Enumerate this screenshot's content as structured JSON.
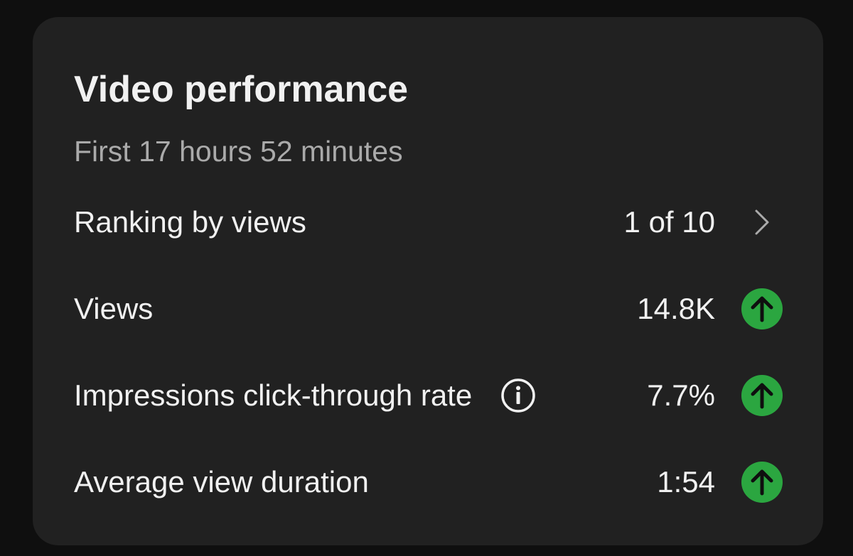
{
  "card": {
    "title": "Video performance",
    "subtitle": "First 17 hours 52 minutes"
  },
  "ranking": {
    "label": "Ranking by views",
    "value": "1 of 10",
    "icon": "chevron-right-icon"
  },
  "metrics": [
    {
      "label": "Views",
      "value": "14.8K",
      "trend": "up",
      "trend_icon": "arrow-up-circle-icon"
    },
    {
      "label": "Impressions click-through rate",
      "value": "7.7%",
      "trend": "up",
      "trend_icon": "arrow-up-circle-icon",
      "info_icon": "info-icon"
    },
    {
      "label": "Average view duration",
      "value": "1:54",
      "trend": "up",
      "trend_icon": "arrow-up-circle-icon"
    }
  ],
  "colors": {
    "background": "#0f0f0f",
    "card": "#212121",
    "text_primary": "#f1f1f1",
    "text_secondary": "#aaaaaa",
    "trend_up": "#2ba640"
  }
}
